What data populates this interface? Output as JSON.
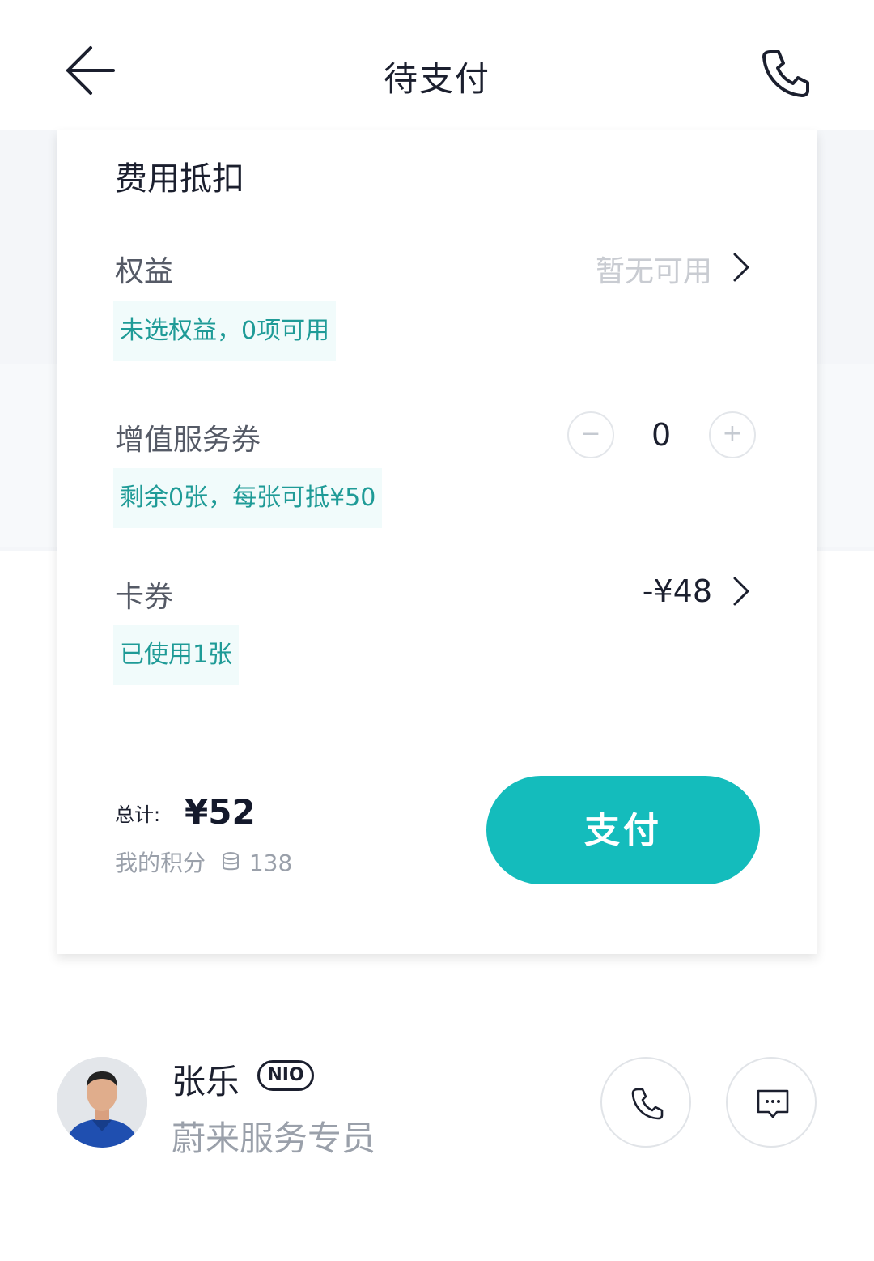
{
  "header": {
    "title": "待支付"
  },
  "deduction": {
    "section_title": "费用抵扣",
    "rights": {
      "label": "权益",
      "status": "暂无可用",
      "note": "未选权益，0项可用"
    },
    "value_added_coupon": {
      "label": "增值服务券",
      "quantity": "0",
      "minus": "−",
      "plus": "+",
      "note": "剩余0张，每张可抵¥50"
    },
    "card_coupon": {
      "label": "卡券",
      "amount": "-¥48",
      "note": "已使用1张"
    }
  },
  "summary": {
    "total_label": "总计:",
    "total_value": "¥52",
    "points_label": "我的积分",
    "points_value": "138",
    "pay_label": "支付"
  },
  "specialist": {
    "name": "张乐",
    "badge": "NIO",
    "role": "蔚来服务专员"
  },
  "colors": {
    "accent": "#14bcbc",
    "chip_bg": "#f1fbfb",
    "chip_text": "#1f9b97"
  }
}
